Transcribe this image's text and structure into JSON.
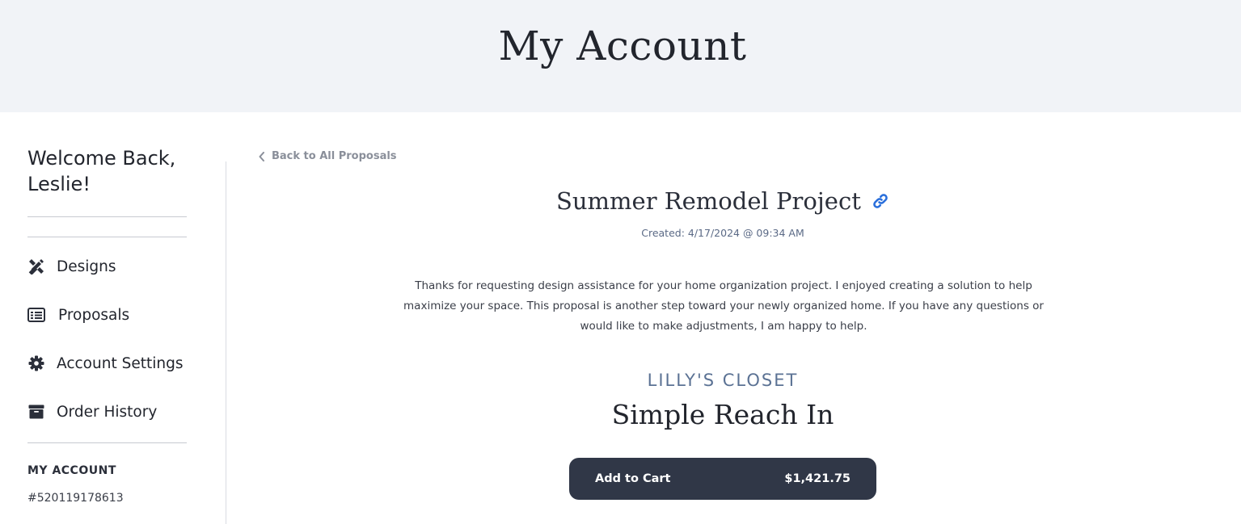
{
  "header": {
    "title": "My Account"
  },
  "sidebar": {
    "welcome": "Welcome Back, Leslie!",
    "items": [
      {
        "label": "Designs",
        "icon": "pencil-ruler-icon"
      },
      {
        "label": "Proposals",
        "icon": "list-alt-icon"
      },
      {
        "label": "Account Settings",
        "icon": "gear-icon"
      },
      {
        "label": "Order History",
        "icon": "archive-box-icon"
      }
    ],
    "account_heading": "MY ACCOUNT",
    "account_number": "#520119178613"
  },
  "main": {
    "back_link": "Back to All Proposals",
    "project_title": "Summer Remodel Project",
    "created": "Created: 4/17/2024 @ 09:34 AM",
    "description": "Thanks for requesting design assistance for your home organization project. I enjoyed creating a solution to help maximize your space. This proposal is another step toward your newly organized home. If you have any questions or would like to make adjustments, I am happy to help.",
    "brand": "LILLY'S CLOSET",
    "design_name": "Simple Reach In",
    "cart_button": {
      "label": "Add to Cart",
      "price": "$1,421.75"
    }
  },
  "colors": {
    "header_bg": "#f1f3f7",
    "link_blue": "#2a6fdb",
    "button_bg": "#303747",
    "brand_text": "#5b7294"
  }
}
